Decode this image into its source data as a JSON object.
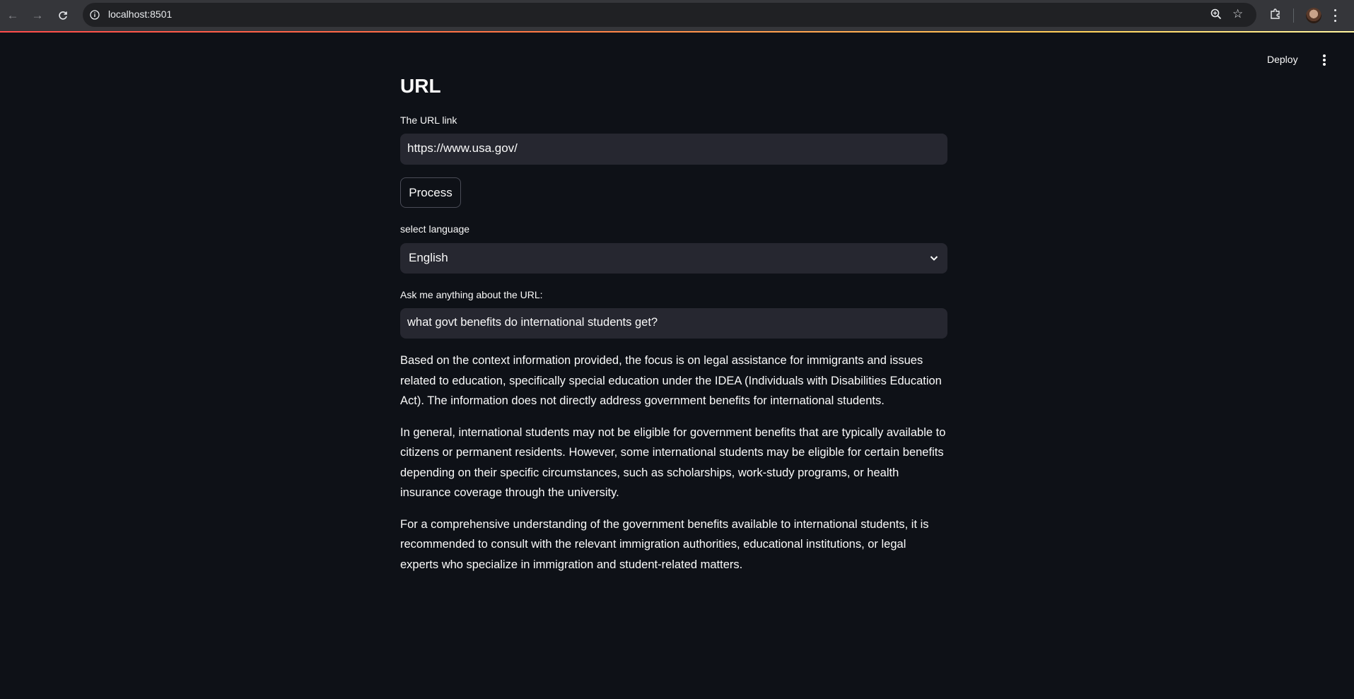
{
  "browser": {
    "url": "localhost:8501"
  },
  "app": {
    "deploy_label": "Deploy"
  },
  "page": {
    "title": "URL",
    "url_label": "The URL link",
    "url_value": "https://www.usa.gov/",
    "process_label": "Process",
    "language_label": "select language",
    "language_value": "English",
    "question_label": "Ask me anything about the URL:",
    "question_value": "what govt benefits do international students get?"
  },
  "answer": {
    "paragraphs": [
      "Based on the context information provided, the focus is on legal assistance for immigrants and issues related to education, specifically special education under the IDEA (Individuals with Disabilities Education Act). The information does not directly address government benefits for international students.",
      "In general, international students may not be eligible for government benefits that are typically available to citizens or permanent residents. However, some international students may be eligible for certain benefits depending on their specific circumstances, such as scholarships, work-study programs, or health insurance coverage through the university.",
      "For a comprehensive understanding of the government benefits available to international students, it is recommended to consult with the relevant immigration authorities, educational institutions, or legal experts who specialize in immigration and student-related matters."
    ]
  },
  "icons": {
    "back": "arrow-left-icon",
    "forward": "arrow-right-icon",
    "reload": "reload-icon",
    "info": "info-icon",
    "zoom": "zoom-icon",
    "bookmark": "star-icon",
    "extensions": "puzzle-icon",
    "menu": "kebab-menu-icon",
    "dropdown": "chevron-down-icon"
  },
  "colors": {
    "background": "#0e1117",
    "input_bg": "#262730",
    "text": "#fafafa",
    "accent": "#ff4b4b"
  }
}
